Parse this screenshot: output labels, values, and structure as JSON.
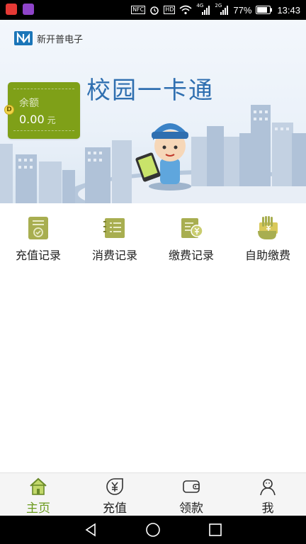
{
  "status_bar": {
    "left_app_colors": [
      "#e53935",
      "#8e44c9"
    ],
    "nfc": "NFC",
    "hd": "HD",
    "net1": "4G",
    "net2": "2G",
    "battery": "77%",
    "time": "13:43"
  },
  "banner": {
    "brand": "新开普电子",
    "title": "校园一卡通",
    "balance": {
      "label": "余额",
      "value": "0.00",
      "unit": "元",
      "coin_symbol": "D"
    }
  },
  "functions": [
    {
      "label": "充值记录",
      "icon": "clipboard-check-icon"
    },
    {
      "label": "消费记录",
      "icon": "notebook-list-icon"
    },
    {
      "label": "缴费记录",
      "icon": "document-yen-icon"
    },
    {
      "label": "自助缴费",
      "icon": "hand-card-icon"
    }
  ],
  "tabs": [
    {
      "label": "主页",
      "icon": "home-icon",
      "active": true
    },
    {
      "label": "充值",
      "icon": "yen-coin-icon",
      "active": false
    },
    {
      "label": "领款",
      "icon": "wallet-icon",
      "active": false
    },
    {
      "label": "我",
      "icon": "person-icon",
      "active": false
    }
  ],
  "colors": {
    "accent": "#7fa018",
    "active_tab": "#6a9a1c",
    "title": "#2f6fb0",
    "icon_olive": "#a8ae50"
  }
}
